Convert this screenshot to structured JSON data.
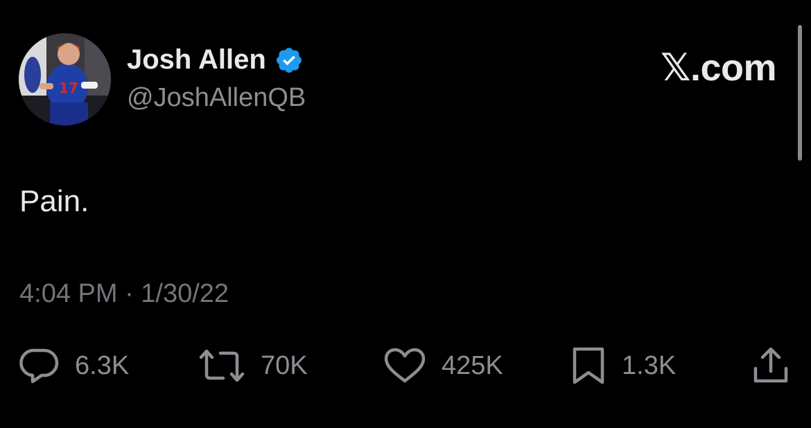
{
  "author": {
    "display_name": "Josh Allen",
    "handle": "@JoshAllenQB",
    "verified": true,
    "verified_color": "#1d9bf0"
  },
  "brand": "𝕏.com",
  "tweet": {
    "text": "Pain.",
    "timestamp": "4:04 PM · 1/30/22"
  },
  "actions": {
    "reply": {
      "icon": "reply-icon",
      "count": "6.3K"
    },
    "repost": {
      "icon": "repost-icon",
      "count": "70K"
    },
    "like": {
      "icon": "heart-icon",
      "count": "425K"
    },
    "bookmark": {
      "icon": "bookmark-icon",
      "count": "1.3K"
    },
    "share": {
      "icon": "share-icon"
    }
  },
  "colors": {
    "background": "#000000",
    "text_primary": "#e7e9ea",
    "text_secondary": "#71767b"
  }
}
